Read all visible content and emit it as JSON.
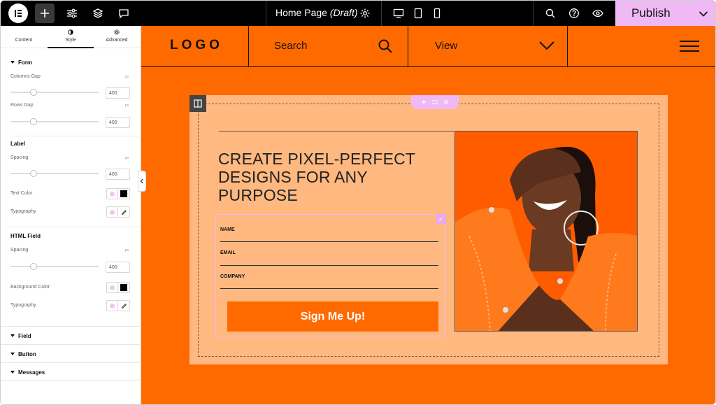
{
  "topbar": {
    "doc_title": "Home Page",
    "doc_status": "(Draft)",
    "publish_label": "Publish"
  },
  "panel": {
    "tabs": [
      {
        "label": "Content",
        "icon": "pencil-icon"
      },
      {
        "label": "Style",
        "icon": "half-circle-icon"
      },
      {
        "label": "Advanced",
        "icon": "gear-icon"
      }
    ],
    "form": {
      "title": "Form",
      "columns_gap_label": "Columns Gap",
      "columns_gap_unit": "px",
      "columns_gap_value": "400",
      "rows_gap_label": "Rows Gap",
      "rows_gap_unit": "px",
      "rows_gap_value": "400"
    },
    "label": {
      "title": "Label",
      "spacing_label": "Spacing",
      "spacing_unit": "px",
      "spacing_value": "400",
      "text_color_label": "Text Color",
      "typography_label": "Typography"
    },
    "html_field": {
      "title": "HTML Field",
      "spacing_label": "Spacing",
      "spacing_unit": "px",
      "spacing_value": "400",
      "bg_color_label": "Background Color",
      "typography_label": "Typography"
    },
    "collapsed_sections": [
      "Field",
      "Button",
      "Messages"
    ]
  },
  "site": {
    "logo": "LOGO",
    "search_label": "Search",
    "view_label": "View",
    "headline": "CREATE PIXEL-PERFECT DESIGNS FOR ANY PURPOSE",
    "fields": [
      "NAME",
      "EMAIL",
      "COMPANY"
    ],
    "submit_label": "Sign Me Up!"
  }
}
